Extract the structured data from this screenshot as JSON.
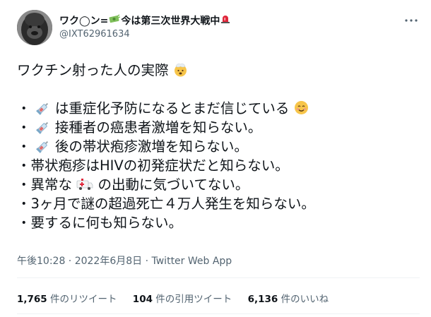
{
  "user": {
    "name_prefix": "ワク◯ン=",
    "name_suffix": "今は第三次世界大戦中",
    "handle": "@IXT62961634"
  },
  "tweet": {
    "line1": "ワクチン射った人の実際",
    "bullet": "・",
    "l2": "は重症化予防になるとまだ信じている",
    "l3": "接種者の癌患者激増を知らない。",
    "l4": "後の帯状疱疹激増を知らない。",
    "l5": "帯状疱疹はHIVの初発症状だと知らない。",
    "l6a": "異常な",
    "l6b": "の出動に気づいてない。",
    "l7": "3ヶ月で謎の超過死亡４万人発生を知らない。",
    "l8": "要するに何も知らない。"
  },
  "meta": {
    "timestamp": "午後10:28 · 2022年6月8日",
    "separator": " · ",
    "app": "Twitter Web App"
  },
  "stats": {
    "retweets_count": "1,765",
    "retweets_label": "件のリツイート",
    "quotes_count": "104",
    "quotes_label": "件の引用ツイート",
    "likes_count": "6,136",
    "likes_label": "件のいいね"
  },
  "icons": {
    "more": "more-options-icon",
    "syringe": "syringe-emoji-icon",
    "money": "money-emoji-icon",
    "siren": "siren-emoji-icon",
    "exploding_head": "exploding-head-emoji-icon",
    "smile": "smile-emoji-icon",
    "ambulance": "ambulance-emoji-icon"
  }
}
